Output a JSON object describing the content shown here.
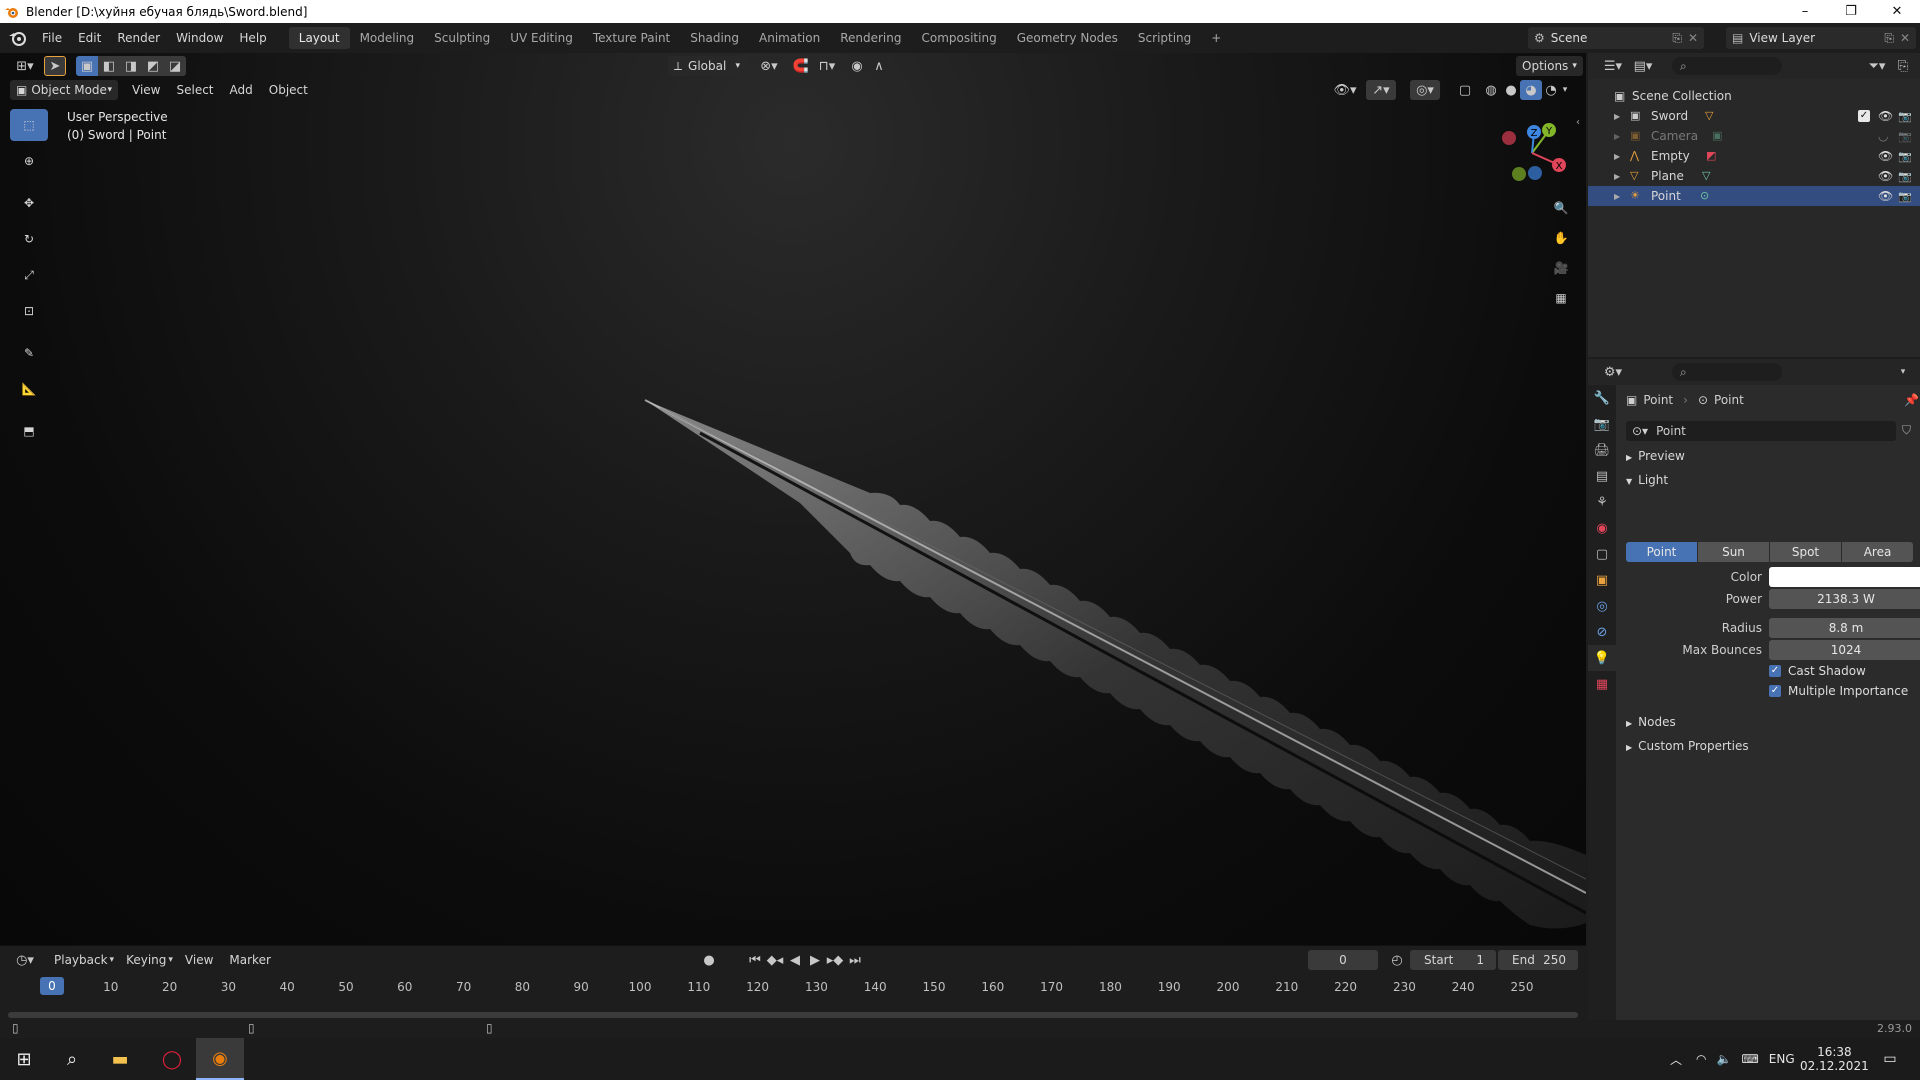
{
  "window": {
    "title": "Blender [D:\\хуйня ебучая блядь\\Sword.blend]",
    "controls": [
      "–",
      "❐",
      "✕"
    ]
  },
  "topbar": {
    "menus": [
      "File",
      "Edit",
      "Render",
      "Window",
      "Help"
    ],
    "workspaces": [
      "Layout",
      "Modeling",
      "Sculpting",
      "UV Editing",
      "Texture Paint",
      "Shading",
      "Animation",
      "Rendering",
      "Compositing",
      "Geometry Nodes",
      "Scripting"
    ],
    "active_workspace": "Layout",
    "add_workspace": "+",
    "scene": "Scene",
    "view_layer": "View Layer"
  },
  "viewport": {
    "transform_orientation": "Global",
    "options_label": "Options",
    "mode": "Object Mode",
    "menus": [
      "View",
      "Select",
      "Add",
      "Object"
    ],
    "overlay_text_1": "User Perspective",
    "overlay_text_2": "(0) Sword | Point",
    "gizmo": {
      "z": "Z",
      "y": "Y",
      "x": "X"
    }
  },
  "timeline": {
    "menus": [
      "Playback",
      "Keying",
      "View",
      "Marker"
    ],
    "current_frame": "0",
    "start_label": "Start",
    "start_value": "1",
    "end_label": "End",
    "end_value": "250",
    "ticks": [
      "0",
      "10",
      "20",
      "30",
      "40",
      "50",
      "60",
      "70",
      "80",
      "90",
      "100",
      "110",
      "120",
      "130",
      "140",
      "150",
      "160",
      "170",
      "180",
      "190",
      "200",
      "210",
      "220",
      "230",
      "240",
      "250"
    ]
  },
  "outliner": {
    "root": "Scene Collection",
    "items": [
      {
        "name": "Sword",
        "type": "mesh",
        "selected": false,
        "disabled": false
      },
      {
        "name": "Camera",
        "type": "camera",
        "selected": false,
        "disabled": true
      },
      {
        "name": "Empty",
        "type": "empty",
        "selected": false,
        "disabled": false
      },
      {
        "name": "Plane",
        "type": "mesh",
        "selected": false,
        "disabled": false
      },
      {
        "name": "Point",
        "type": "light",
        "selected": true,
        "disabled": false
      }
    ]
  },
  "properties": {
    "breadcrumb_object": "Point",
    "breadcrumb_data": "Point",
    "datablock_name": "Point",
    "panels": {
      "preview": "Preview",
      "light": "Light",
      "nodes": "Nodes",
      "custom_properties": "Custom Properties"
    },
    "light_types": [
      "Point",
      "Sun",
      "Spot",
      "Area"
    ],
    "active_light_type": "Point",
    "fields": {
      "color_label": "Color",
      "color_value": "#ffffff",
      "power_label": "Power",
      "power_value": "2138.3 W",
      "radius_label": "Radius",
      "radius_value": "8.8 m",
      "max_bounces_label": "Max Bounces",
      "max_bounces_value": "1024"
    },
    "checkboxes": {
      "cast_shadow": "Cast Shadow",
      "multiple_importance": "Multiple Importance"
    }
  },
  "statusbar": {
    "version": "2.93.0"
  },
  "taskbar": {
    "language": "ENG",
    "time": "16:38",
    "date": "02.12.2021"
  },
  "colors": {
    "accent": "#4772b3",
    "selected_row": "#334d80",
    "gizmo_x": "#e0455a",
    "gizmo_y": "#83b629",
    "gizmo_z": "#3e87e0"
  }
}
